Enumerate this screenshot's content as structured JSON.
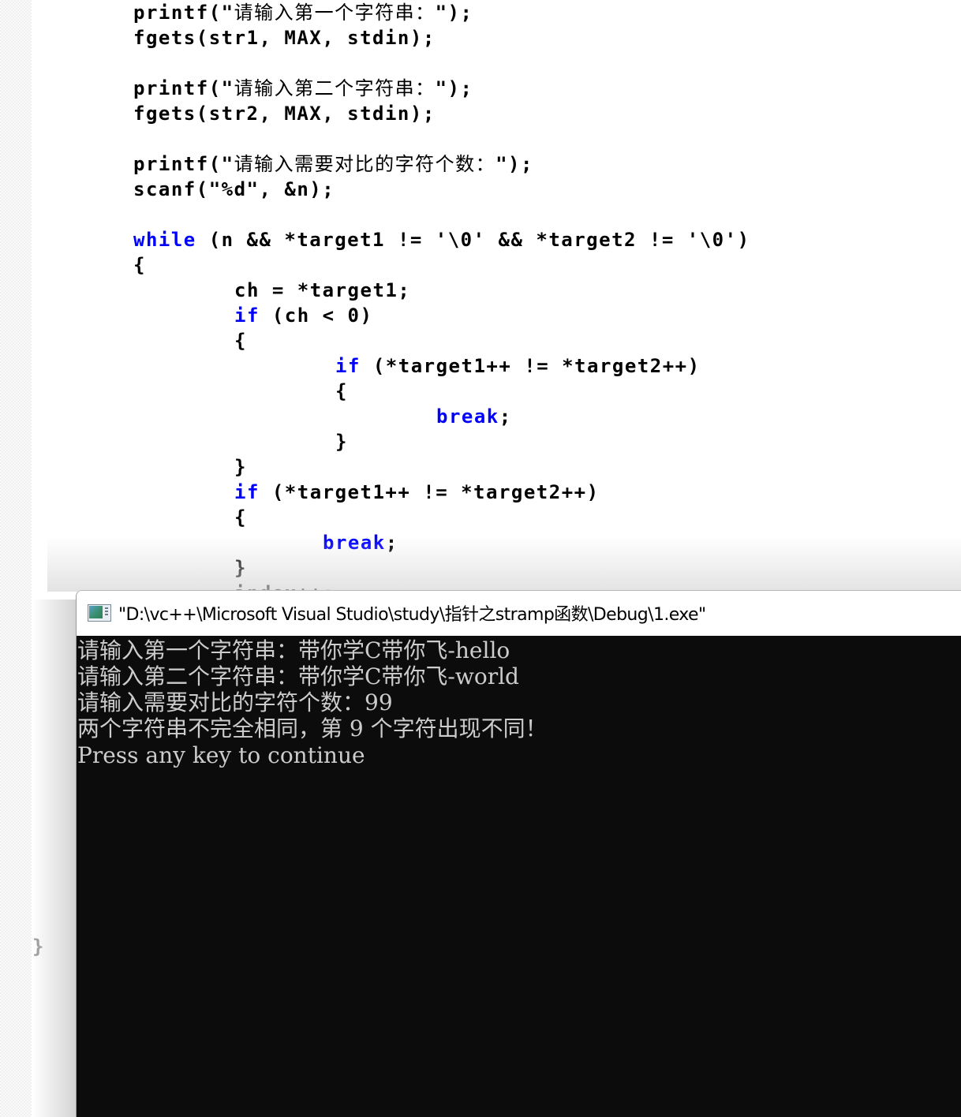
{
  "editor": {
    "keyword_color": "#0000ff",
    "lines": [
      {
        "row": 0,
        "indent": 8,
        "parts": [
          {
            "t": "printf(\""
          },
          {
            "t": "请输入第一个字符串：",
            "cjk": true
          },
          {
            "t": "\");"
          }
        ]
      },
      {
        "row": 1,
        "indent": 8,
        "parts": [
          {
            "t": "fgets(str1, MAX, stdin);"
          }
        ]
      },
      {
        "row": 3,
        "indent": 8,
        "parts": [
          {
            "t": "printf(\""
          },
          {
            "t": "请输入第二个字符串：",
            "cjk": true
          },
          {
            "t": "\");"
          }
        ]
      },
      {
        "row": 4,
        "indent": 8,
        "parts": [
          {
            "t": "fgets(str2, MAX, stdin);"
          }
        ]
      },
      {
        "row": 6,
        "indent": 8,
        "parts": [
          {
            "t": "printf(\""
          },
          {
            "t": "请输入需要对比的字符个数：",
            "cjk": true
          },
          {
            "t": "\");"
          }
        ]
      },
      {
        "row": 7,
        "indent": 8,
        "parts": [
          {
            "t": "scanf(\"%d\", &n);"
          }
        ]
      },
      {
        "row": 9,
        "indent": 8,
        "parts": [
          {
            "t": "while",
            "kw": true
          },
          {
            "t": " (n && *target1 != '\\0' && *target2 != '\\0')"
          }
        ]
      },
      {
        "row": 10,
        "indent": 8,
        "parts": [
          {
            "t": "{"
          }
        ]
      },
      {
        "row": 11,
        "indent": 16,
        "parts": [
          {
            "t": "ch = *target1;"
          }
        ]
      },
      {
        "row": 12,
        "indent": 16,
        "parts": [
          {
            "t": "if",
            "kw": true
          },
          {
            "t": " (ch < 0)"
          }
        ]
      },
      {
        "row": 13,
        "indent": 16,
        "parts": [
          {
            "t": "{"
          }
        ]
      },
      {
        "row": 14,
        "indent": 24,
        "parts": [
          {
            "t": "if",
            "kw": true
          },
          {
            "t": " (*target1++ != *target2++)"
          }
        ]
      },
      {
        "row": 15,
        "indent": 24,
        "parts": [
          {
            "t": "{"
          }
        ]
      },
      {
        "row": 16,
        "indent": 32,
        "parts": [
          {
            "t": "break",
            "kw": true
          },
          {
            "t": ";"
          }
        ]
      },
      {
        "row": 17,
        "indent": 24,
        "parts": [
          {
            "t": "}"
          }
        ]
      },
      {
        "row": 18,
        "indent": 16,
        "parts": [
          {
            "t": "}"
          }
        ]
      },
      {
        "row": 19,
        "indent": 16,
        "parts": [
          {
            "t": "if",
            "kw": true
          },
          {
            "t": " (*target1++ != *target2++)"
          }
        ]
      },
      {
        "row": 20,
        "indent": 16,
        "parts": [
          {
            "t": "{"
          }
        ]
      },
      {
        "row": 21,
        "indent": 23,
        "parts": [
          {
            "t": "break",
            "kw": true
          },
          {
            "t": ";"
          }
        ]
      },
      {
        "row": 22,
        "indent": 16,
        "parts": [
          {
            "t": "}"
          }
        ]
      },
      {
        "row": 23,
        "indent": 16,
        "parts": [
          {
            "t": "index++;"
          }
        ]
      },
      {
        "row": 37,
        "indent": 0,
        "parts": [
          {
            "t": "}"
          }
        ]
      }
    ]
  },
  "console": {
    "title": "\"D:\\vc++\\Microsoft Visual Studio\\study\\指针之stramp函数\\Debug\\1.exe\"",
    "icon": "console-app-icon",
    "background": "#0c0c0c",
    "text_color": "#cccccc",
    "output_lines": [
      "请输入第一个字符串：带你学C带你飞-hello",
      "请输入第二个字符串：带你学C带你飞-world",
      "请输入需要对比的字符个数：99",
      "两个字符串不完全相同，第 9 个字符出现不同！",
      "Press any key to continue"
    ]
  }
}
